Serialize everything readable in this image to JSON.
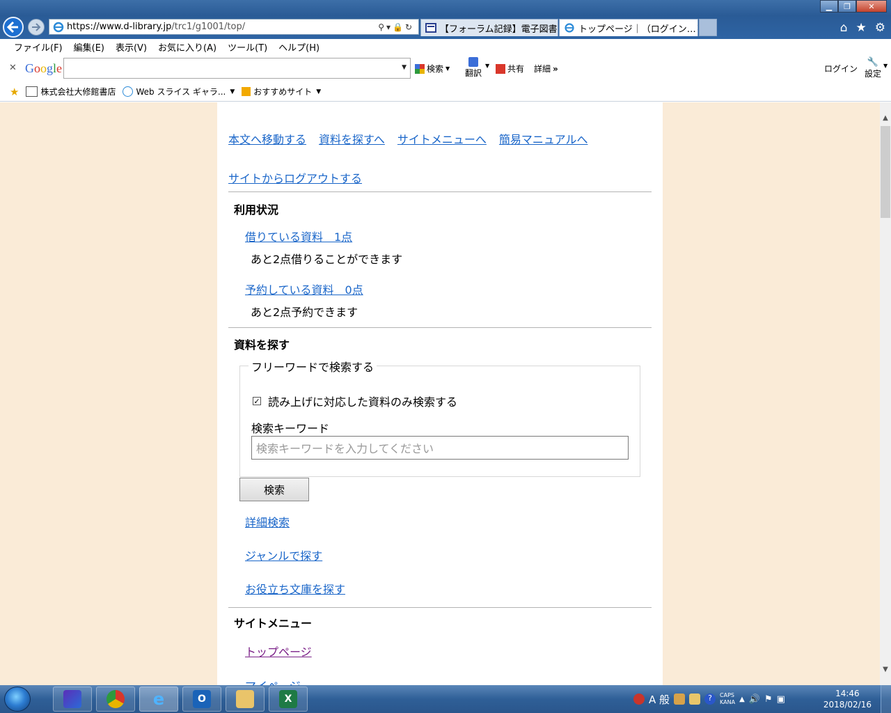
{
  "browser": {
    "address_host": "https://www.d-library.jp",
    "address_path": "/trc1/g1001/top/",
    "tabs": [
      {
        "label": "【フォーラム記録】電子図書…"
      },
      {
        "label": "トップページ｜（ログイン…"
      }
    ],
    "tab_close_glyph": "×"
  },
  "menubar": {
    "items": [
      "ファイル(F)",
      "編集(E)",
      "表示(V)",
      "お気に入り(A)",
      "ツール(T)",
      "ヘルプ(H)"
    ]
  },
  "google_toolbar": {
    "logo": "Google",
    "search_label": "検索",
    "translate_label": "翻訳",
    "share_label": "共有",
    "more_label": "詳細",
    "login_label": "ログイン",
    "settings_label": "設定"
  },
  "favorites": {
    "items": [
      "株式会社大修館書店",
      "Web スライス ギャラ...",
      "おすすめサイト"
    ]
  },
  "page": {
    "skip_links": [
      "本文へ移動する",
      "資料を探すへ",
      "サイトメニューへ",
      "簡易マニュアルへ"
    ],
    "logout_link": "サイトからログアウトする",
    "usage": {
      "heading": "利用状況",
      "borrowed_link": "借りている資料　1点",
      "borrowed_note": "あと2点借りることができます",
      "reserved_link": "予約している資料　0点",
      "reserved_note": "あと2点予約できます"
    },
    "search": {
      "heading": "資料を探す",
      "legend": "フリーワードで検索する",
      "checkbox_label": "読み上げに対応した資料のみ検索する",
      "checkbox_checked": true,
      "keyword_label": "検索キーワード",
      "keyword_placeholder": "検索キーワードを入力してください",
      "button": "検索",
      "advanced_link": "詳細検索",
      "genre_link": "ジャンルで探す",
      "library_link": "お役立ち文庫を探す"
    },
    "site_menu": {
      "heading": "サイトメニュー",
      "items": [
        "トップページ",
        "マイページ"
      ]
    }
  },
  "taskbar": {
    "clock_time": "14:46",
    "clock_date": "2018/02/16",
    "ime_mode": "般",
    "caps": "CAPS",
    "kana": "KANA"
  },
  "colors": {
    "page_background": "#faebd7",
    "link": "#1a66c9",
    "visited_link": "#7a1f87"
  }
}
